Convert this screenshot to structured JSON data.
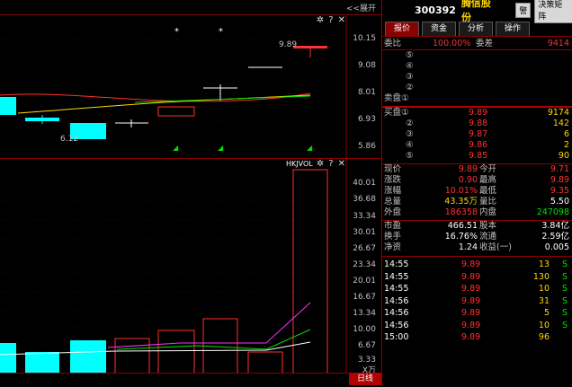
{
  "toolbar": {
    "expand_label": "<<展开",
    "icons": [
      "gear-icon",
      "help-icon",
      "close-icon"
    ]
  },
  "price_axis": [
    "10.15",
    "9.08",
    "8.01",
    "6.93",
    "5.86"
  ],
  "price_labels": {
    "high": "9.89",
    "low": "6.12"
  },
  "markers": {
    "star": "*",
    "arrow": "◢"
  },
  "volume": {
    "indicator": "HKJVOL",
    "axis": [
      "40.01",
      "36.68",
      "33.34",
      "30.01",
      "26.67",
      "23.34",
      "20.01",
      "16.67",
      "13.34",
      "10.00",
      "6.67",
      "3.33"
    ],
    "unit": "X万"
  },
  "bottom_tab": "日线",
  "stock": {
    "code": "300392",
    "name": "腾信股份"
  },
  "header_buttons": [
    "警",
    "决策矩阵"
  ],
  "tabs": [
    "报价",
    "资金",
    "分析",
    "操作"
  ],
  "weibi": {
    "label1": "委比",
    "val1": "100.00%",
    "label2": "委差",
    "val2": "9414"
  },
  "sell_label": "卖盘",
  "sell_levels": [
    {
      "label": "⑤",
      "price": "",
      "vol": ""
    },
    {
      "label": "④",
      "price": "",
      "vol": ""
    },
    {
      "label": "③",
      "price": "",
      "vol": ""
    },
    {
      "label": "②",
      "price": "",
      "vol": ""
    },
    {
      "label": "卖盘①",
      "price": "",
      "vol": ""
    }
  ],
  "buy_levels": [
    {
      "label": "买盘①",
      "price": "9.89",
      "vol": "9174"
    },
    {
      "label": "②",
      "price": "9.88",
      "vol": "142"
    },
    {
      "label": "③",
      "price": "9.87",
      "vol": "6"
    },
    {
      "label": "④",
      "price": "9.86",
      "vol": "2"
    },
    {
      "label": "⑤",
      "price": "9.85",
      "vol": "90"
    }
  ],
  "stats": [
    {
      "l1": "现价",
      "v1": "9.89",
      "l2": "今开",
      "v2": "9.71",
      "c1": "red",
      "c2": "red"
    },
    {
      "l1": "涨跌",
      "v1": "0.90",
      "l2": "最高",
      "v2": "9.89",
      "c1": "red",
      "c2": "red"
    },
    {
      "l1": "涨幅",
      "v1": "10.01%",
      "l2": "最低",
      "v2": "9.35",
      "c1": "red",
      "c2": "red"
    },
    {
      "l1": "总量",
      "v1": "43.35万",
      "l2": "量比",
      "v2": "5.50",
      "c1": "yel",
      "c2": "wht"
    },
    {
      "l1": "外盘",
      "v1": "186358",
      "l2": "内盘",
      "v2": "247098",
      "c1": "red",
      "c2": "grn"
    }
  ],
  "stats2": [
    {
      "l1": "市盈",
      "v1": "466.51",
      "l2": "股本",
      "v2": "3.84亿"
    },
    {
      "l1": "换手",
      "v1": "16.76%",
      "l2": "流通",
      "v2": "2.59亿"
    },
    {
      "l1": "净资",
      "v1": "1.24",
      "l2": "收益(一)",
      "v2": "0.005"
    }
  ],
  "ticks": [
    {
      "time": "14:55",
      "price": "9.89",
      "vol": "13",
      "flag": "S"
    },
    {
      "time": "14:55",
      "price": "9.89",
      "vol": "130",
      "flag": "S"
    },
    {
      "time": "14:55",
      "price": "9.89",
      "vol": "10",
      "flag": "S"
    },
    {
      "time": "14:56",
      "price": "9.89",
      "vol": "31",
      "flag": "S"
    },
    {
      "time": "14:56",
      "price": "9.89",
      "vol": "5",
      "flag": "S"
    },
    {
      "time": "14:56",
      "price": "9.89",
      "vol": "10",
      "flag": "S"
    },
    {
      "time": "15:00",
      "price": "9.89",
      "vol": "96",
      "flag": ""
    }
  ],
  "colors": {
    "up": "#ff3030",
    "down": "#00ffff",
    "accent": "#8b0000"
  }
}
